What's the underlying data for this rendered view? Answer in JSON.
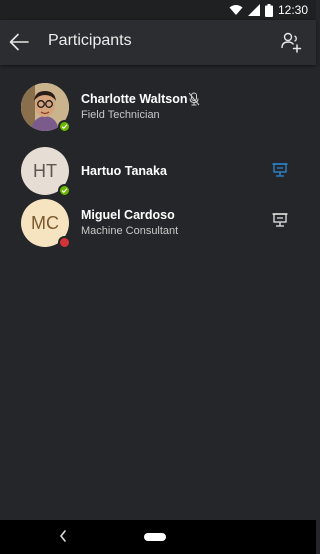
{
  "status_bar": {
    "time": "12:30"
  },
  "header": {
    "title": "Participants"
  },
  "participants": [
    {
      "name": "Charlotte Waltson",
      "role": "Field Technician",
      "initials": "",
      "presence": "available",
      "muted": true
    },
    {
      "name": "Hartuo Tanaka",
      "role": "",
      "initials": "HT",
      "presence": "available",
      "presenting": true
    },
    {
      "name": "Miguel Cardoso",
      "role": "Machine Consultant",
      "initials": "MC",
      "presence": "busy",
      "presenting": false
    }
  ],
  "colors": {
    "background": "#252629",
    "app_bar": "#2c2d30",
    "accent_blue": "#2a8ad4",
    "presence_green": "#6bb700",
    "presence_red": "#d13438"
  }
}
